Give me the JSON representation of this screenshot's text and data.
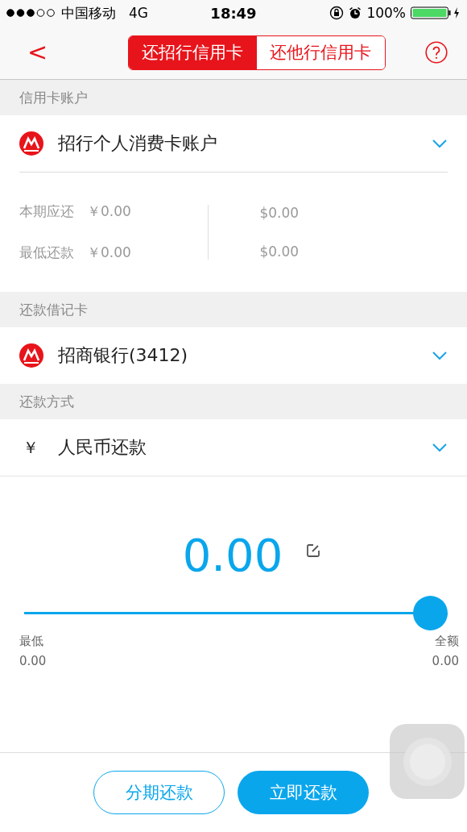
{
  "status_bar": {
    "carrier": "中国移动",
    "network": "4G",
    "time": "18:49",
    "battery": "100%"
  },
  "nav": {
    "back": "<",
    "tabs": [
      {
        "label": "还招行信用卡",
        "selected": true
      },
      {
        "label": "还他行信用卡",
        "selected": false
      }
    ]
  },
  "credit_section": {
    "header": "信用卡账户",
    "account": "招行个人消费卡账户",
    "rows": [
      {
        "label": "本期应还",
        "rmb": "￥0.00",
        "usd": "$0.00"
      },
      {
        "label": "最低还款",
        "rmb": "￥0.00",
        "usd": "$0.00"
      }
    ]
  },
  "debit_section": {
    "header": "还款借记卡",
    "card": "招商银行(3412)"
  },
  "method_section": {
    "header": "还款方式",
    "symbol": "￥",
    "method": "人民币还款"
  },
  "amount": {
    "value": "0.00",
    "slider": {
      "level": 1,
      "min_label": "最低",
      "min_value": "0.00",
      "max_label": "全额",
      "max_value": "0.00"
    }
  },
  "buttons": [
    {
      "label": "分期还款",
      "kind": "outline"
    },
    {
      "label": "立即还款",
      "kind": "filled"
    }
  ]
}
